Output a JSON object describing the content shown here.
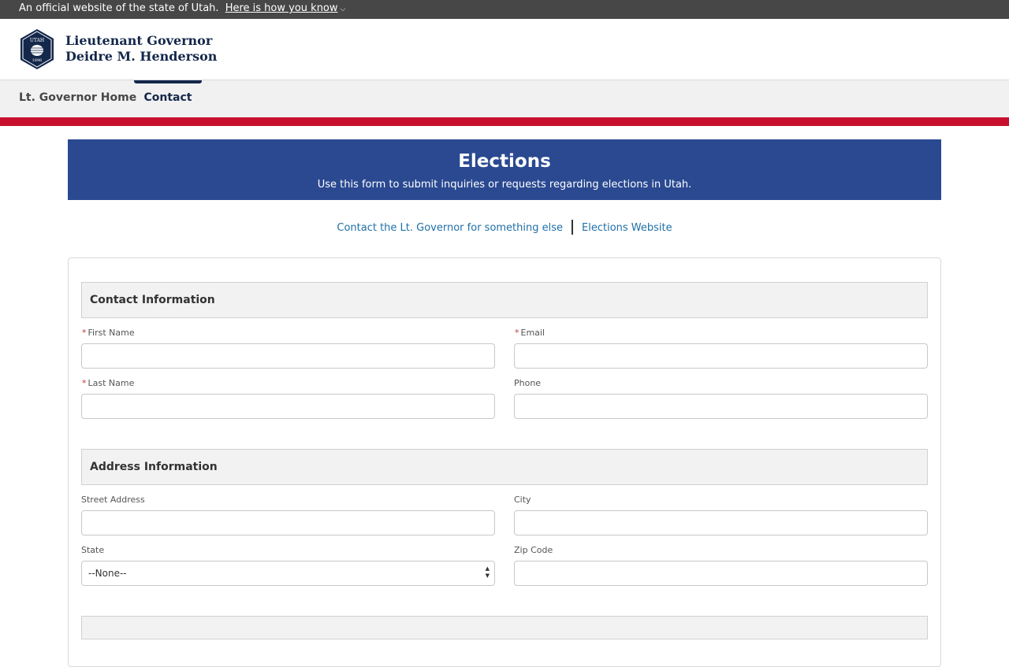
{
  "topbar": {
    "official_text": "An official website of the state of Utah.",
    "how_link": "Here is how you know"
  },
  "header": {
    "seal_top_text": "UTAH",
    "seal_year": "1896",
    "brand_line1": "Lieutenant Governor",
    "brand_line2": "Deidre M. Henderson"
  },
  "nav": {
    "items": [
      {
        "label": "Lt. Governor Home"
      },
      {
        "label": "Contact"
      }
    ]
  },
  "banner": {
    "title": "Elections",
    "subtitle": "Use this form to submit inquiries or requests regarding elections in Utah."
  },
  "links": {
    "contact_other": "Contact the Lt. Governor for something else",
    "elections_site": "Elections Website"
  },
  "form": {
    "contact_section": "Contact Information",
    "first_name": "First Name",
    "email": "Email",
    "last_name": "Last Name",
    "phone": "Phone",
    "required_mark": "*",
    "address_section": "Address Information",
    "street": "Street Address",
    "city": "City",
    "state": "State",
    "state_value": "--None--",
    "zip": "Zip Code"
  },
  "colors": {
    "brand_navy": "#14284b",
    "banner_blue": "#2a4991",
    "accent_red": "#c8102e",
    "link_blue": "#1f6fa8"
  }
}
